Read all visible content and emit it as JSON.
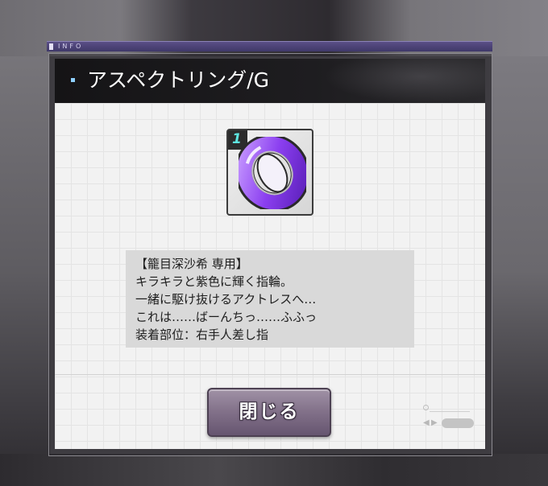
{
  "info_bar": {
    "label": "INFO"
  },
  "dialog": {
    "title": "アスペクトリング/G"
  },
  "item": {
    "level": "1",
    "icon": "purple-ring-icon"
  },
  "description": {
    "lines": [
      "【籠目深沙希 専用】",
      "キラキラと紫色に輝く指輪。",
      "一緒に駆け抜けるアクトレスへ…",
      "これは……ばーんちっ……ふふっ",
      "装着部位：右手人差し指"
    ]
  },
  "buttons": {
    "close_label": "閉じる"
  },
  "colors": {
    "accent": "#8fd0ff",
    "button": "#84738b",
    "ring": "#8b3ff0",
    "badge_text": "#5ee6e0"
  }
}
